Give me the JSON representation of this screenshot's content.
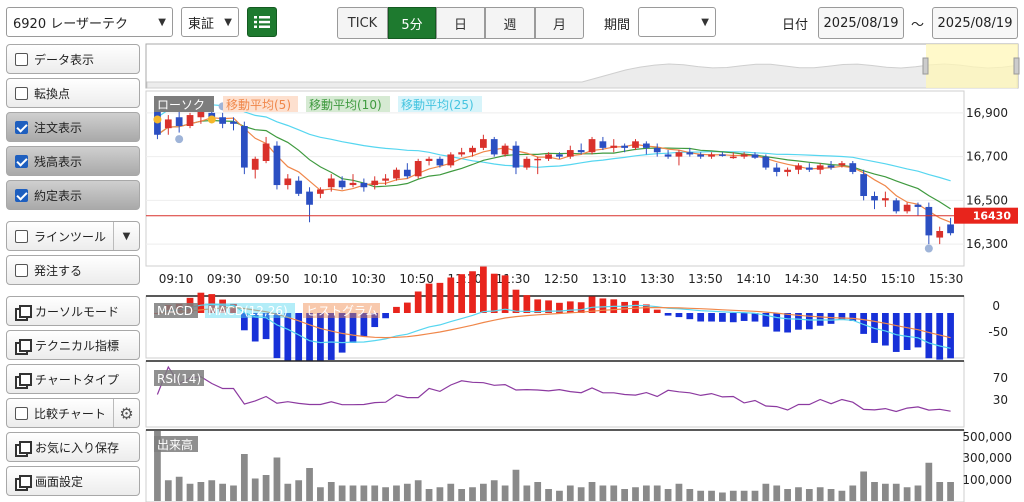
{
  "toolbar": {
    "symbol": "6920 レーザーテク",
    "market": "東証",
    "periods": [
      "TICK",
      "5分",
      "日",
      "週",
      "月"
    ],
    "active_period": "5分",
    "range_label": "期間",
    "range_value": "",
    "date_label": "日付",
    "date_from": "2025/08/19",
    "date_sep": "～",
    "date_to": "2025/08/19"
  },
  "sidebar": {
    "items": [
      {
        "label": "データ表示",
        "kind": "check",
        "checked": false
      },
      {
        "label": "転換点",
        "kind": "check",
        "checked": false
      },
      {
        "label": "注文表示",
        "kind": "check",
        "checked": true
      },
      {
        "label": "残高表示",
        "kind": "check",
        "checked": true
      },
      {
        "label": "約定表示",
        "kind": "check",
        "checked": true
      },
      {
        "label": "ラインツール",
        "kind": "check-drop",
        "checked": false
      },
      {
        "label": "発注する",
        "kind": "check",
        "checked": false
      },
      {
        "label": "カーソルモード",
        "kind": "window"
      },
      {
        "label": "テクニカル指標",
        "kind": "window"
      },
      {
        "label": "チャートタイプ",
        "kind": "window"
      },
      {
        "label": "比較チャート",
        "kind": "check-gear",
        "checked": false
      },
      {
        "label": "お気に入り保存",
        "kind": "window"
      },
      {
        "label": "画面設定",
        "kind": "window"
      }
    ]
  },
  "colors": {
    "accent": "#1e7a2f",
    "up": "#d9312b",
    "down": "#2b4fc2",
    "ma5": "#f0874a",
    "ma10": "#3f9a3f",
    "ma25": "#56d6f0",
    "price_line": "#d9312b",
    "rsi": "#8c3aa0",
    "volume": "#8a8a8a"
  },
  "chart_data": {
    "type": "candlestick",
    "legend": [
      "ローソク",
      "移動平均(5)",
      "移動平均(10)",
      "移動平均(25)"
    ],
    "y_ticks": [
      16900,
      16700,
      16500,
      16300
    ],
    "ylim": [
      16200,
      17000
    ],
    "current_price": 16430,
    "x_ticks": [
      "09:10",
      "09:30",
      "09:50",
      "10:10",
      "10:30",
      "10:50",
      "11:10",
      "11:30",
      "12:50",
      "13:10",
      "13:30",
      "13:50",
      "14:10",
      "14:30",
      "14:50",
      "15:10",
      "15:30"
    ],
    "candles": [
      [
        16920,
        16970,
        16780,
        16800
      ],
      [
        16830,
        16890,
        16800,
        16870
      ],
      [
        16880,
        16920,
        16810,
        16840
      ],
      [
        16840,
        16900,
        16830,
        16890
      ],
      [
        16880,
        16930,
        16850,
        16910
      ],
      [
        16900,
        16960,
        16870,
        16880
      ],
      [
        16880,
        16900,
        16830,
        16850
      ],
      [
        16860,
        16880,
        16820,
        16850
      ],
      [
        16840,
        16860,
        16620,
        16650
      ],
      [
        16640,
        16700,
        16600,
        16690
      ],
      [
        16680,
        16790,
        16670,
        16760
      ],
      [
        16750,
        16770,
        16550,
        16570
      ],
      [
        16570,
        16620,
        16550,
        16600
      ],
      [
        16590,
        16610,
        16520,
        16530
      ],
      [
        16540,
        16560,
        16400,
        16480
      ],
      [
        16530,
        16560,
        16510,
        16550
      ],
      [
        16560,
        16620,
        16540,
        16600
      ],
      [
        16590,
        16610,
        16550,
        16560
      ],
      [
        16570,
        16620,
        16560,
        16580
      ],
      [
        16580,
        16600,
        16540,
        16560
      ],
      [
        16570,
        16610,
        16550,
        16590
      ],
      [
        16590,
        16620,
        16570,
        16600
      ],
      [
        16600,
        16650,
        16590,
        16640
      ],
      [
        16640,
        16670,
        16600,
        16610
      ],
      [
        16610,
        16690,
        16600,
        16680
      ],
      [
        16680,
        16700,
        16660,
        16690
      ],
      [
        16690,
        16700,
        16650,
        16660
      ],
      [
        16660,
        16720,
        16650,
        16710
      ],
      [
        16710,
        16740,
        16700,
        16720
      ],
      [
        16720,
        16750,
        16700,
        16740
      ],
      [
        16740,
        16800,
        16730,
        16780
      ],
      [
        16780,
        16790,
        16700,
        16710
      ],
      [
        16710,
        16760,
        16700,
        16750
      ],
      [
        16750,
        16770,
        16620,
        16650
      ],
      [
        16650,
        16700,
        16640,
        16690
      ],
      [
        16690,
        16700,
        16620,
        16690
      ],
      [
        16690,
        16720,
        16680,
        16710
      ],
      [
        16710,
        16720,
        16690,
        16700
      ],
      [
        16700,
        16750,
        16690,
        16730
      ],
      [
        16730,
        16760,
        16710,
        16720
      ],
      [
        16720,
        16790,
        16710,
        16780
      ],
      [
        16770,
        16790,
        16730,
        16740
      ],
      [
        16740,
        16780,
        16720,
        16750
      ],
      [
        16750,
        16760,
        16720,
        16740
      ],
      [
        16740,
        16780,
        16730,
        16770
      ],
      [
        16760,
        16770,
        16710,
        16740
      ],
      [
        16740,
        16760,
        16700,
        16720
      ],
      [
        16710,
        16730,
        16690,
        16700
      ],
      [
        16700,
        16730,
        16660,
        16720
      ],
      [
        16720,
        16740,
        16700,
        16710
      ],
      [
        16710,
        16720,
        16690,
        16700
      ],
      [
        16700,
        16720,
        16690,
        16710
      ],
      [
        16710,
        16720,
        16700,
        16705
      ],
      [
        16700,
        16720,
        16690,
        16700
      ],
      [
        16700,
        16720,
        16690,
        16710
      ],
      [
        16710,
        16720,
        16690,
        16695
      ],
      [
        16700,
        16710,
        16640,
        16650
      ],
      [
        16650,
        16670,
        16610,
        16630
      ],
      [
        16630,
        16650,
        16610,
        16640
      ],
      [
        16640,
        16670,
        16620,
        16660
      ],
      [
        16650,
        16670,
        16630,
        16640
      ],
      [
        16640,
        16670,
        16620,
        16660
      ],
      [
        16660,
        16680,
        16640,
        16650
      ],
      [
        16660,
        16680,
        16650,
        16670
      ],
      [
        16670,
        16680,
        16620,
        16630
      ],
      [
        16620,
        16640,
        16500,
        16520
      ],
      [
        16520,
        16540,
        16460,
        16500
      ],
      [
        16500,
        16540,
        16470,
        16510
      ],
      [
        16500,
        16510,
        16440,
        16450
      ],
      [
        16450,
        16490,
        16440,
        16480
      ],
      [
        16480,
        16490,
        16430,
        16470
      ],
      [
        16470,
        16490,
        16300,
        16340
      ],
      [
        16330,
        16380,
        16300,
        16360
      ],
      [
        16390,
        16420,
        16340,
        16350
      ]
    ],
    "macd": {
      "label": "MACD",
      "signal_label": "MACD(12,26)",
      "hist_label": "ヒストグラム",
      "y_ticks": [
        0,
        -50
      ]
    },
    "rsi": {
      "label": "RSI(14)",
      "y_ticks": [
        70,
        30
      ]
    },
    "volume": {
      "label": "出来高",
      "y_ticks": [
        500000,
        300000,
        100000
      ],
      "y_tick_labels": [
        "500,000",
        "300,000",
        "100,000"
      ]
    }
  }
}
